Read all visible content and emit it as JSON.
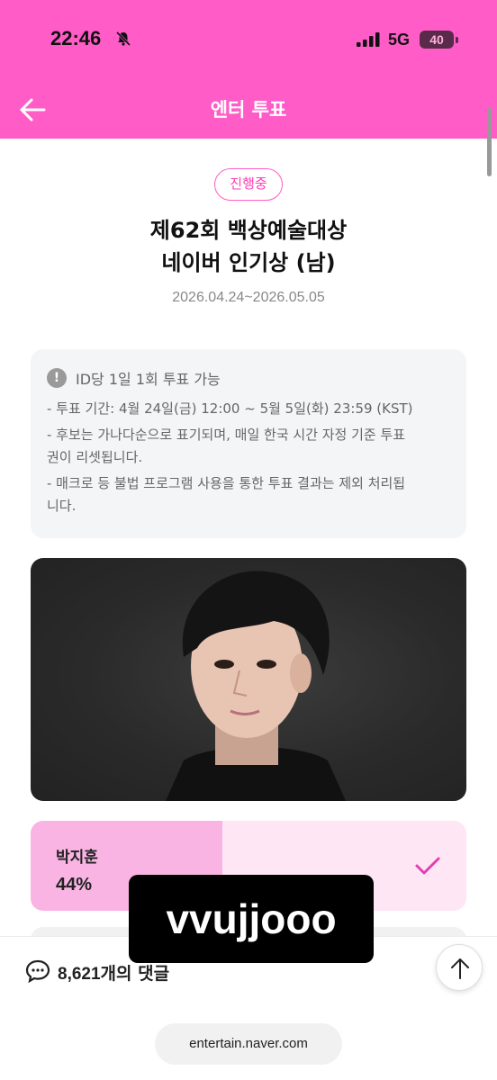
{
  "status_bar": {
    "time": "22:46",
    "network": "5G",
    "battery": "40"
  },
  "app_bar": {
    "title": "엔터 투표"
  },
  "vote_info": {
    "status_badge": "진행중",
    "title_line1": "제62회 백상예술대상",
    "title_line2": "네이버 인기상 (남)",
    "period": "2026.04.24~2026.05.05"
  },
  "notice": {
    "heading": "ID당 1일 1회 투표 가능",
    "lines": [
      "- 투표 기간: 4월 24일(금) 12:00 ~ 5월 5일(화) 23:59 (KST)",
      "- 후보는 가나다순으로 표기되며, 매일 한국 시간 자정 기준 투표",
      "권이 리셋됩니다.",
      "- 매크로 등 불법 프로그램 사용을 통한 투표 결과는 제외 처리됩",
      "니다."
    ]
  },
  "candidate": {
    "name": "박지훈",
    "percent_label": "44%",
    "share": 0.44
  },
  "bottom": {
    "comment_count": "8,621",
    "comment_suffix": "개의 댓글",
    "url": "entertain.naver.com"
  },
  "watermark": "vvujjooo",
  "colors": {
    "brand_pink": "#ff5cc8",
    "vote_fill": "#f9b4e4",
    "vote_bg": "#ffe6f5"
  }
}
